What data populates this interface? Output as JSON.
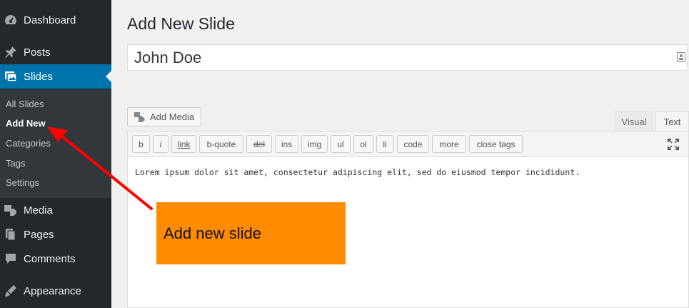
{
  "sidebar": {
    "items": [
      {
        "label": "Dashboard",
        "icon": "dashboard-icon"
      },
      {
        "label": "Posts",
        "icon": "pin-icon"
      },
      {
        "label": "Slides",
        "icon": "slides-icon",
        "active": true
      },
      {
        "label": "Media",
        "icon": "media-icon"
      },
      {
        "label": "Pages",
        "icon": "pages-icon"
      },
      {
        "label": "Comments",
        "icon": "comments-icon"
      },
      {
        "label": "Appearance",
        "icon": "appearance-icon"
      }
    ],
    "submenu": [
      {
        "label": "All Slides"
      },
      {
        "label": "Add New",
        "current": true
      },
      {
        "label": "Categories"
      },
      {
        "label": "Tags"
      },
      {
        "label": "Settings"
      }
    ]
  },
  "main": {
    "title": "Add New Slide",
    "title_value": "John Doe",
    "add_media_label": "Add Media",
    "tabs": [
      {
        "label": "Visual"
      },
      {
        "label": "Text",
        "active": true
      }
    ],
    "toolbar": [
      "b",
      "i",
      "link",
      "b-quote",
      "del",
      "ins",
      "img",
      "ul",
      "ol",
      "li",
      "code",
      "more",
      "close tags"
    ],
    "content": "Lorem ipsum dolor sit amet, consectetur adipiscing elit, sed do eiusmod tempor incididunt."
  },
  "annotation": {
    "text": "Add new slide",
    "color": "#ff8c00",
    "arrow_color": "#ff0000"
  },
  "colors": {
    "sidebar": "#23282d",
    "submenu": "#32373c",
    "active": "#0073aa"
  }
}
